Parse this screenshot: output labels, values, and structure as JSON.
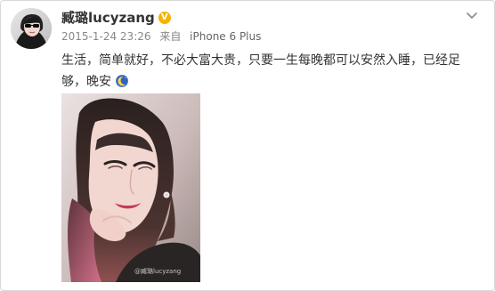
{
  "post": {
    "username": "臧璐lucyzang",
    "timestamp": "2015-1-24 23:26",
    "source_prefix": "来自",
    "source_device": "iPhone 6 Plus",
    "text": "生活，简单就好，不必大富大贵，只要一生每晚都可以安然入睡，已经足够，晚安",
    "emoji_icon": "moon-emoji-icon",
    "verified_badge": "V",
    "watermark": "@臧璐lucyzang"
  },
  "icons": {
    "avatar": "avatar",
    "verified": "verified-badge-icon",
    "menu": "chevron-down-icon",
    "emoji": "moon-emoji-icon"
  },
  "colors": {
    "name": "#333333",
    "meta": "#888888",
    "verified": "#f4b400",
    "border": "#d9d9d9"
  }
}
